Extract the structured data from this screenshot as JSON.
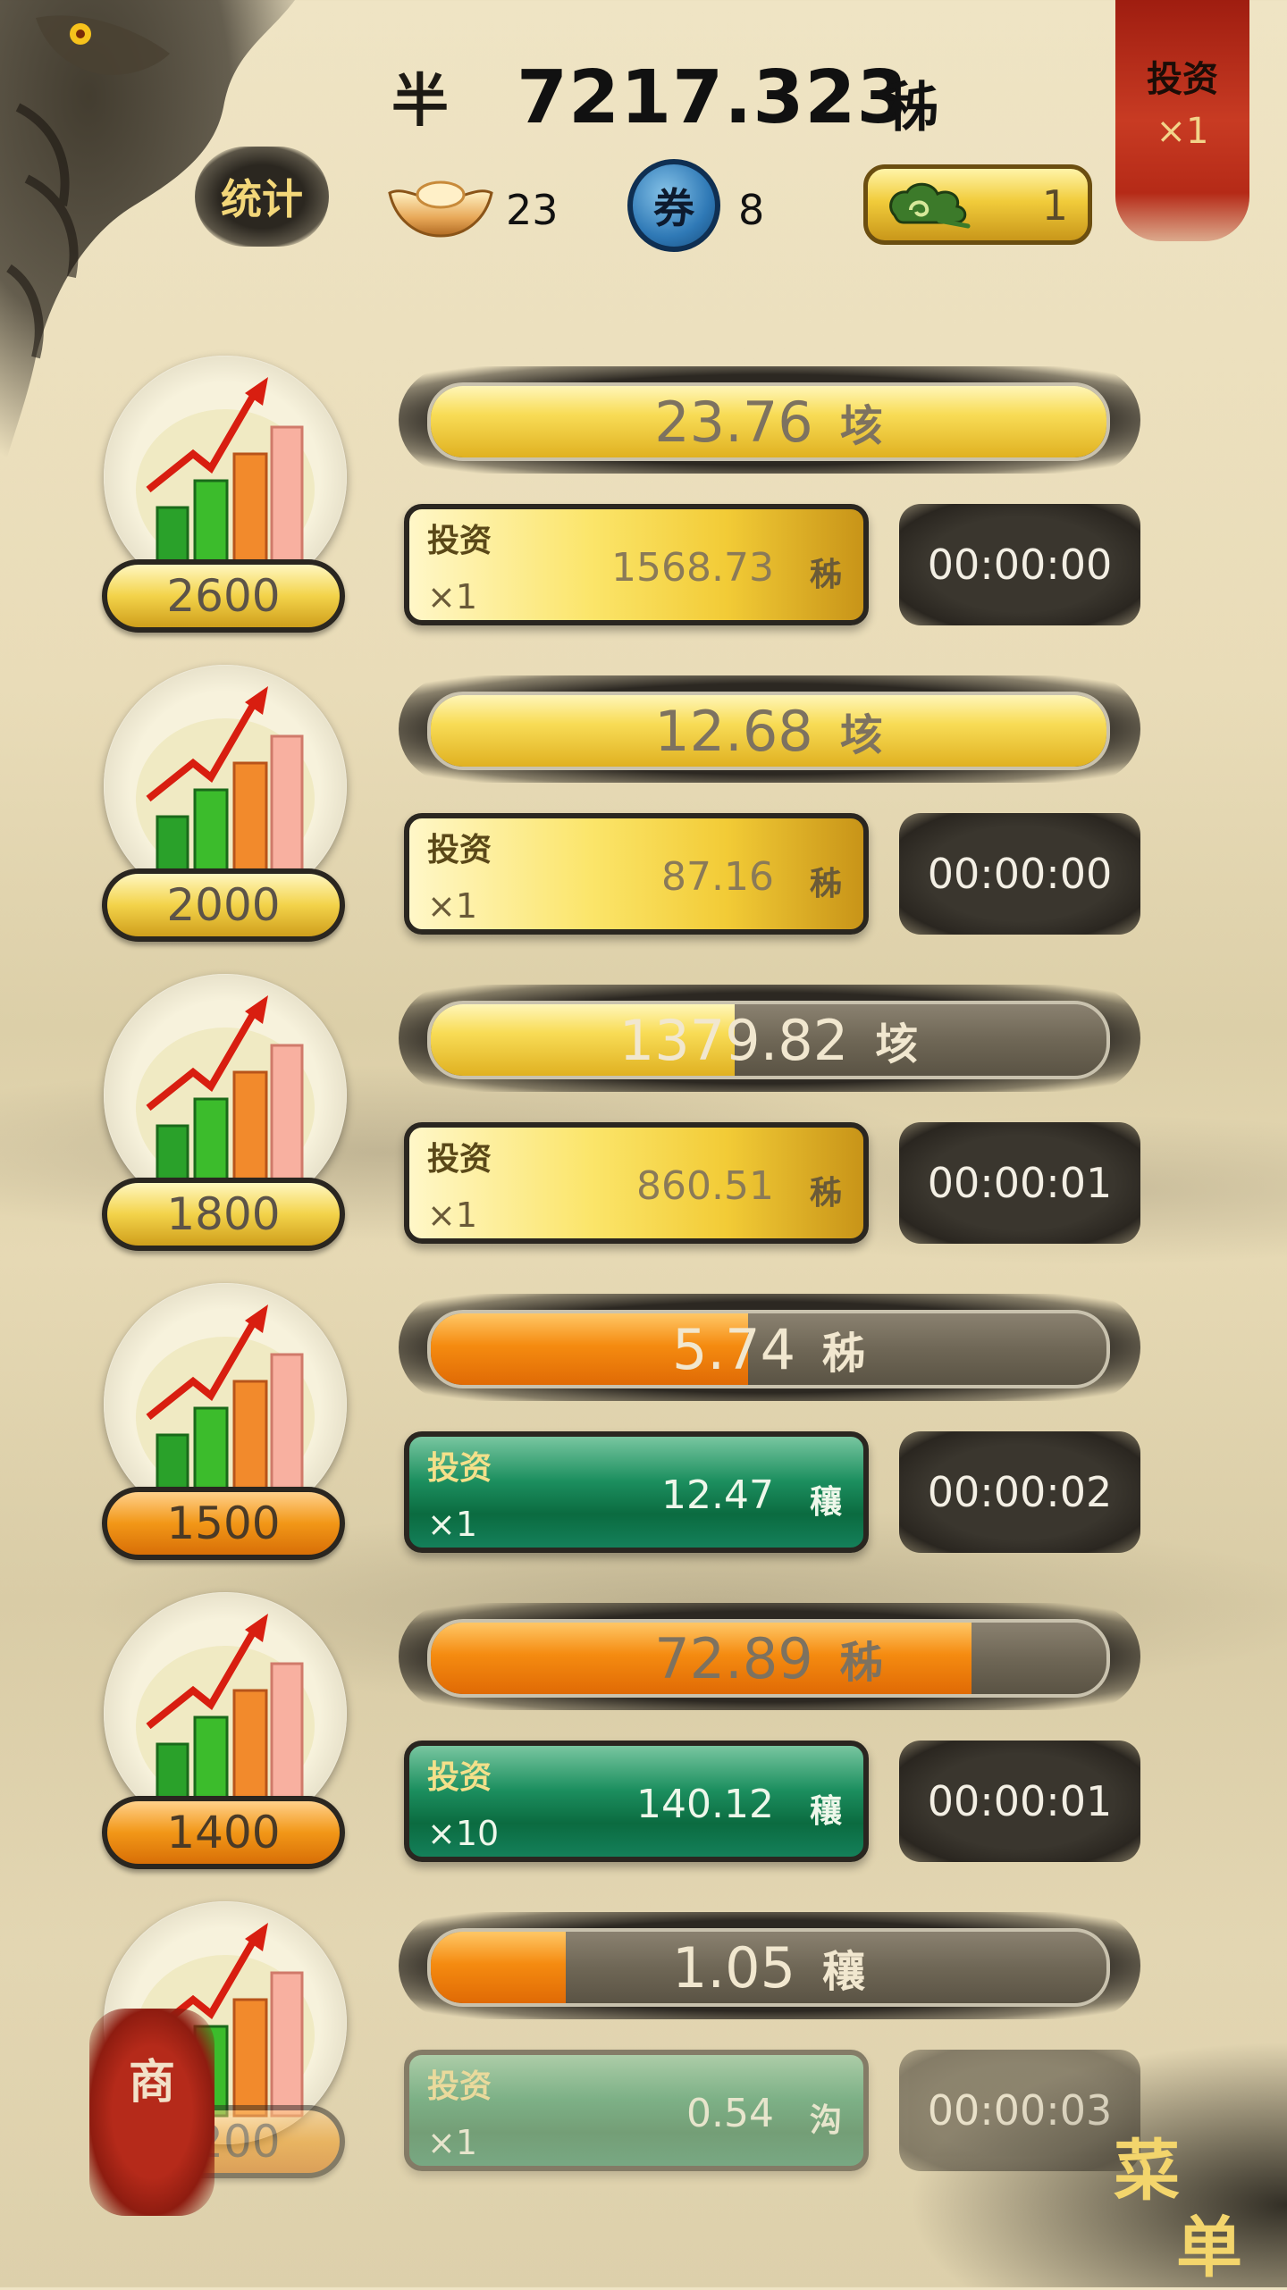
{
  "header": {
    "money_glyph": "半",
    "money_value": "7217.323",
    "money_unit": "秭",
    "stats_label": "统计",
    "ingot_count": "23",
    "coupon_label": "券",
    "coupon_count": "8",
    "cloud_count": "1",
    "invest_banner_label": "投资",
    "invest_banner_mult": "×1"
  },
  "rows": [
    {
      "level": "2600",
      "bar_value": "23.76",
      "bar_unit": "垓",
      "bar_progress": 1.0,
      "bar_color": "gold",
      "invest_label": "投资",
      "invest_mult": "×1",
      "invest_cost": "1568.73",
      "invest_cost_unit": "秭",
      "invest_color": "gold",
      "timer": "00:00:00"
    },
    {
      "level": "2000",
      "bar_value": "12.68",
      "bar_unit": "垓",
      "bar_progress": 1.0,
      "bar_color": "gold",
      "invest_label": "投资",
      "invest_mult": "×1",
      "invest_cost": "87.16",
      "invest_cost_unit": "秭",
      "invest_color": "gold",
      "timer": "00:00:00"
    },
    {
      "level": "1800",
      "bar_value": "1379.82",
      "bar_unit": "垓",
      "bar_progress": 0.45,
      "bar_color": "gold",
      "invest_label": "投资",
      "invest_mult": "×1",
      "invest_cost": "860.51",
      "invest_cost_unit": "秭",
      "invest_color": "gold",
      "timer": "00:00:01"
    },
    {
      "level": "1500",
      "bar_value": "5.74",
      "bar_unit": "秭",
      "bar_progress": 0.47,
      "bar_color": "orange",
      "invest_label": "投资",
      "invest_mult": "×1",
      "invest_cost": "12.47",
      "invest_cost_unit": "穰",
      "invest_color": "green",
      "timer": "00:00:02"
    },
    {
      "level": "1400",
      "bar_value": "72.89",
      "bar_unit": "秭",
      "bar_progress": 0.8,
      "bar_color": "orange",
      "invest_label": "投资",
      "invest_mult": "×10",
      "invest_cost": "140.12",
      "invest_cost_unit": "穰",
      "invest_color": "green",
      "timer": "00:00:01"
    },
    {
      "level": "1200",
      "bar_value": "1.05",
      "bar_unit": "穰",
      "bar_progress": 0.2,
      "bar_color": "orange",
      "invest_label": "投资",
      "invest_mult": "×1",
      "invest_cost": "0.54",
      "invest_cost_unit": "沟",
      "invest_color": "green",
      "timer": "00:00:03"
    }
  ],
  "shop_label": "商",
  "menu_label_1": "菜",
  "menu_label_2": "单",
  "colors": {
    "gold": "#f3d34a",
    "orange": "#f29717",
    "green": "#0b6b40",
    "banner_red": "#c83b23"
  }
}
